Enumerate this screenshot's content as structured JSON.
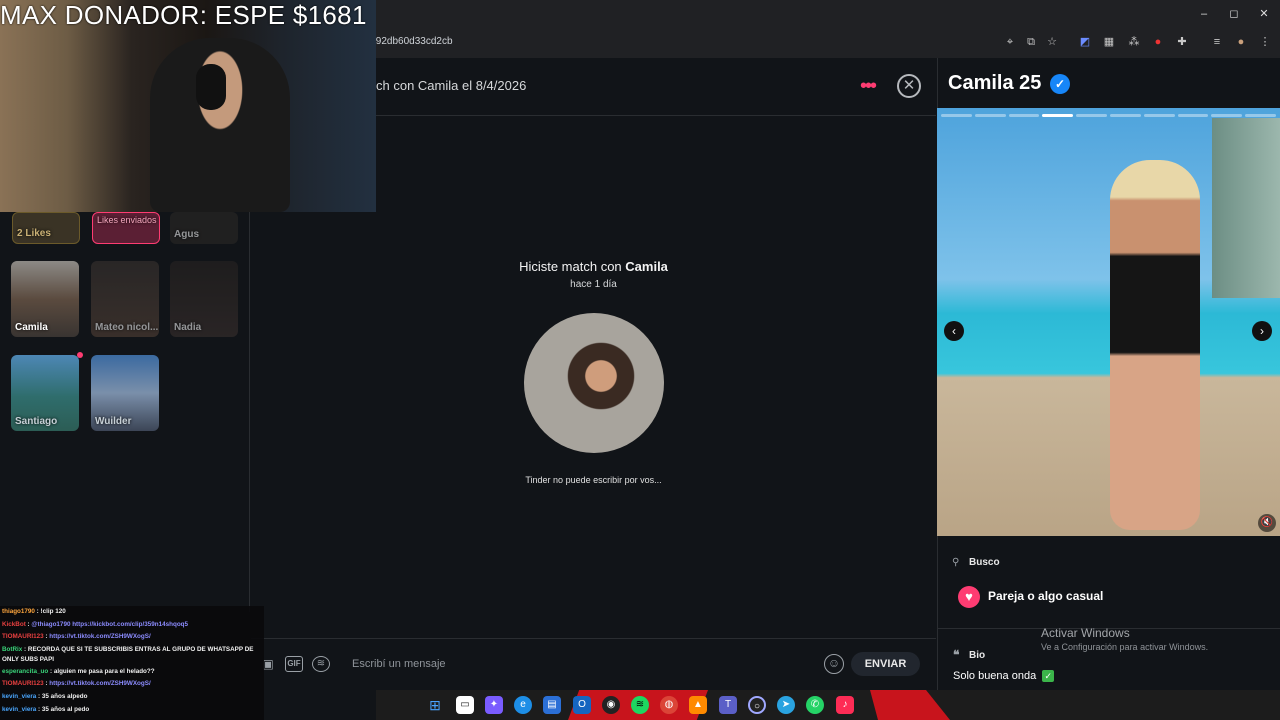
{
  "stream": {
    "overlay_title": "MAX DONADOR: ESPE $1681"
  },
  "browser": {
    "url_fragment": "la92db60d33cd2cb"
  },
  "matches": [
    {
      "name": "2 Likes",
      "kind": "likes"
    },
    {
      "name": "Likes enviados",
      "kind": "sent"
    },
    {
      "name": "Agus"
    },
    {
      "name": "Camila"
    },
    {
      "name": "Mateo nicol..."
    },
    {
      "name": "Nadia"
    },
    {
      "name": "Santiago"
    },
    {
      "name": "Wuilder"
    }
  ],
  "chat": {
    "header": "ch con Camila el 8/4/2026",
    "match_prefix": "Hiciste match con",
    "match_name": "Camila",
    "match_time": "hace 1 día",
    "tinder_note": "Tinder no puede escribir por vos...",
    "composer_placeholder": "Escribí un mensaje",
    "send_label": "ENVIAR",
    "gif_label": "GIF"
  },
  "profile": {
    "name": "Camila",
    "age": "25",
    "busco_label": "Busco",
    "busco_value": "Pareja o algo casual",
    "bio_label": "Bio",
    "bio_value": "Solo buena onda",
    "photo_count": 10,
    "active_photo": 4
  },
  "windows_watermark": {
    "title": "Activar Windows",
    "subtitle": "Ve a Configuración para activar Windows."
  },
  "stream_chat": [
    {
      "user": "thiago1790",
      "msg": "!clip 120"
    },
    {
      "user": "KickBot",
      "msg": "@thiago1790 https://kickbot.com/clip/359n14shqoq5"
    },
    {
      "user": "TIOMAURI123",
      "msg": "https://vt.tiktok.com/ZSH9WXogS/"
    },
    {
      "user": "BotRix",
      "msg": "RECORDA QUE SI TE SUBSCRIBIS ENTRAS AL GRUPO DE WHATSAPP DE ONLY SUBS PAPI"
    },
    {
      "user": "esperancita_uo",
      "msg": "alguien me pasa para el helado??"
    },
    {
      "user": "TIOMAURI123",
      "msg": "https://vt.tiktok.com/ZSH9WXogS/"
    },
    {
      "user": "kevin_viera",
      "msg": "35 años alpedo"
    },
    {
      "user": "kevin_viera",
      "msg": "35 años al pedo"
    }
  ],
  "colors": {
    "accent": "#fe3c72",
    "verified": "#1786f8",
    "background": "#111418"
  }
}
